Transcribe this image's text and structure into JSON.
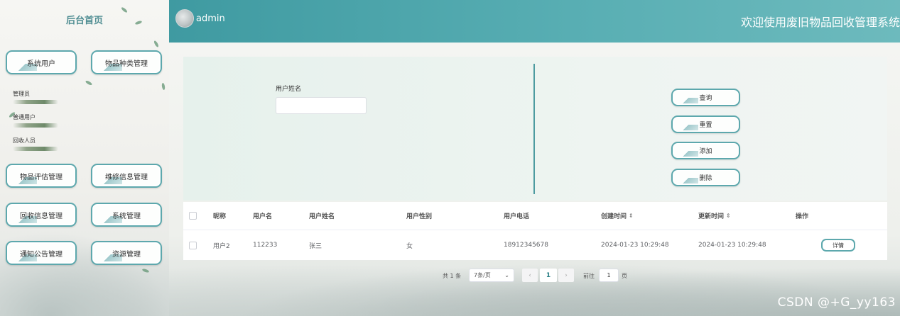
{
  "sidebar": {
    "title": "后台首页",
    "menu": {
      "system_users": "系统用户",
      "item_category": "物品种类管理",
      "item_evaluation": "物品评估管理",
      "repair_info": "维修信息管理",
      "recycle_info": "回收信息管理",
      "system_manage": "系统管理",
      "notice": "通知公告管理",
      "resources": "资源管理"
    },
    "submenu": [
      "管理员",
      "普通用户",
      "回收人员"
    ]
  },
  "topbar": {
    "username": "admin",
    "system_title": "欢迎使用废旧物品回收管理系统"
  },
  "search": {
    "field_label": "用户姓名",
    "field_value": "",
    "field_placeholder": ""
  },
  "actions": {
    "query": "查询",
    "reset": "重置",
    "add": "添加",
    "delete": "删除"
  },
  "table": {
    "columns": [
      "昵称",
      "用户名",
      "用户姓名",
      "用户性别",
      "用户电话",
      "创建时间",
      "更新时间",
      "操作"
    ],
    "sort_icon": "⇕",
    "rows": [
      {
        "nickname": "用户2",
        "username": "112233",
        "real_name": "张三",
        "gender": "女",
        "phone": "18912345678",
        "created": "2024-01-23 10:29:48",
        "updated": "2024-01-23 10:29:48",
        "detail_label": "详情"
      }
    ]
  },
  "pagination": {
    "total_text": "共 1 条",
    "page_size": "7条/页",
    "current_page": "1",
    "goto_label": "前往",
    "goto_value": "1",
    "page_suffix": "页"
  },
  "watermark": "CSDN @+G_yy163",
  "colors": {
    "accent": "#5da8ad",
    "topbar_start": "#3f9aa1",
    "topbar_end": "#6dbabd",
    "sidebar_title": "#4f8d92"
  }
}
